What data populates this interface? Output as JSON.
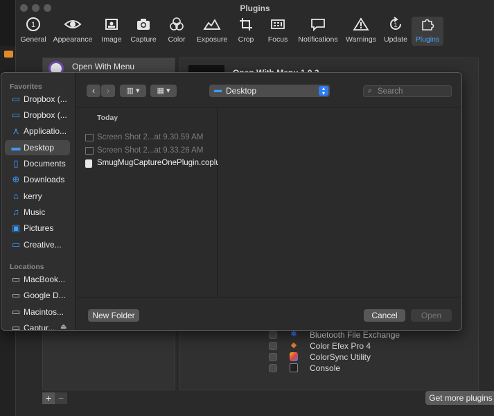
{
  "window": {
    "title": "Plugins"
  },
  "toolbar": {
    "items": [
      {
        "label": "General",
        "icon": "general-icon"
      },
      {
        "label": "Appearance",
        "icon": "eye-icon"
      },
      {
        "label": "Image",
        "icon": "image-icon"
      },
      {
        "label": "Capture",
        "icon": "camera-icon"
      },
      {
        "label": "Color",
        "icon": "color-circles-icon"
      },
      {
        "label": "Exposure",
        "icon": "exposure-icon"
      },
      {
        "label": "Crop",
        "icon": "crop-icon"
      },
      {
        "label": "Focus",
        "icon": "focus-icon"
      },
      {
        "label": "Notifications",
        "icon": "speech-bubble-icon"
      },
      {
        "label": "Warnings",
        "icon": "warning-icon"
      },
      {
        "label": "Update",
        "icon": "update-icon"
      },
      {
        "label": "Plugins",
        "icon": "puzzle-icon",
        "active": true
      }
    ]
  },
  "plugins": {
    "selected_name": "Open With Menu",
    "detail_title": "Open With Menu 1.0.2"
  },
  "apps": [
    {
      "name": "Bluetooth File Exchange",
      "icon": "bluetooth-icon"
    },
    {
      "name": "Color Efex Pro 4",
      "icon": "color-efex-icon"
    },
    {
      "name": "ColorSync Utility",
      "icon": "colorsync-icon"
    },
    {
      "name": "Console",
      "icon": "console-icon"
    }
  ],
  "footer": {
    "add": "+",
    "remove": "−",
    "get_more": "Get more plugins"
  },
  "dialog": {
    "sidebar": {
      "favorites_head": "Favorites",
      "favorites": [
        {
          "label": "Dropbox (...",
          "icon": "folder-icon"
        },
        {
          "label": "Dropbox (...",
          "icon": "folder-icon"
        },
        {
          "label": "Applicatio...",
          "icon": "applications-icon"
        },
        {
          "label": "Desktop",
          "icon": "desktop-icon",
          "selected": true
        },
        {
          "label": "Documents",
          "icon": "document-icon"
        },
        {
          "label": "Downloads",
          "icon": "download-icon"
        },
        {
          "label": "kerry",
          "icon": "home-icon"
        },
        {
          "label": "Music",
          "icon": "music-icon"
        },
        {
          "label": "Pictures",
          "icon": "pictures-icon"
        },
        {
          "label": "Creative...",
          "icon": "folder-icon"
        }
      ],
      "locations_head": "Locations",
      "locations": [
        {
          "label": "MacBook...",
          "icon": "laptop-icon"
        },
        {
          "label": "Google D...",
          "icon": "drive-icon"
        },
        {
          "label": "Macintos...",
          "icon": "disk-icon"
        },
        {
          "label": "Captur...",
          "icon": "disk-icon",
          "eject": true
        }
      ]
    },
    "location": "Desktop",
    "search_placeholder": "Search",
    "column_head": "Today",
    "files": [
      {
        "name": "Screen Shot 2...at 9.30.59 AM",
        "enabled": false
      },
      {
        "name": "Screen Shot 2...at 9.33.26 AM",
        "enabled": false
      },
      {
        "name": "SmugMugCaptureOnePlugin.coplugin",
        "enabled": true
      }
    ],
    "buttons": {
      "new_folder": "New Folder",
      "cancel": "Cancel",
      "open": "Open"
    }
  }
}
